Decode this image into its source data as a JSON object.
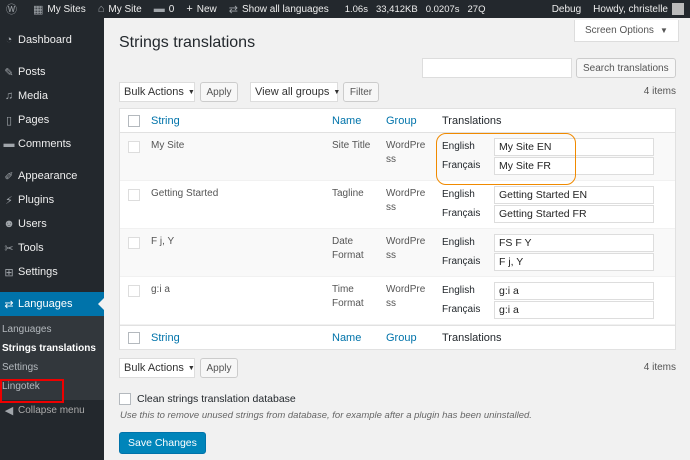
{
  "admin_bar": {
    "my_sites": "My Sites",
    "site": "My Site",
    "comments": "0",
    "new": "New",
    "languages": "Show all languages",
    "debug_time": "1.06s",
    "debug_mem": "33,412KB",
    "debug_q": "0.0207s",
    "debug_queries": "27Q",
    "debug": "Debug",
    "howdy": "Howdy, christelle"
  },
  "sidebar": {
    "items": [
      {
        "label": "Dashboard",
        "icon": "dashboard-icon"
      },
      {
        "label": "Posts",
        "icon": "pin-icon"
      },
      {
        "label": "Media",
        "icon": "media-icon"
      },
      {
        "label": "Pages",
        "icon": "page-icon"
      },
      {
        "label": "Comments",
        "icon": "comment-icon"
      },
      {
        "label": "Appearance",
        "icon": "brush-icon"
      },
      {
        "label": "Plugins",
        "icon": "plug-icon"
      },
      {
        "label": "Users",
        "icon": "user-icon"
      },
      {
        "label": "Tools",
        "icon": "wrench-icon"
      },
      {
        "label": "Settings",
        "icon": "settings-icon"
      },
      {
        "label": "Languages",
        "icon": "translate-icon"
      }
    ],
    "submenu": [
      "Languages",
      "Strings translations",
      "Settings",
      "Lingotek"
    ],
    "collapse": "Collapse menu"
  },
  "page": {
    "screen_options": "Screen Options",
    "title": "Strings translations",
    "search_button": "Search translations",
    "bulk_actions": "Bulk Actions",
    "apply": "Apply",
    "groups": "View all groups",
    "filter": "Filter",
    "items": "4 items"
  },
  "table": {
    "headers": {
      "string": "String",
      "name": "Name",
      "group": "Group",
      "translations": "Translations"
    },
    "languages": [
      "English",
      "Français"
    ],
    "rows": [
      {
        "string": "My Site",
        "name": "Site Title",
        "group": "WordPre ss",
        "en": "My Site EN",
        "fr": "My Site FR"
      },
      {
        "string": "Getting Started",
        "name": "Tagline",
        "group": "WordPre ss",
        "en": "Getting Started EN",
        "fr": "Getting Started FR"
      },
      {
        "string": "F j, Y",
        "name": "Date Format",
        "group": "WordPre ss",
        "en": "FS F Y",
        "fr": "F j, Y"
      },
      {
        "string": "g:i a",
        "name": "Time Format",
        "group": "WordPre ss",
        "en": "g:i a",
        "fr": "g:i a"
      }
    ]
  },
  "footer": {
    "clean_label": "Clean strings translation database",
    "clean_desc": "Use this to remove unused strings from database, for example after a plugin has been uninstalled.",
    "save": "Save Changes"
  }
}
